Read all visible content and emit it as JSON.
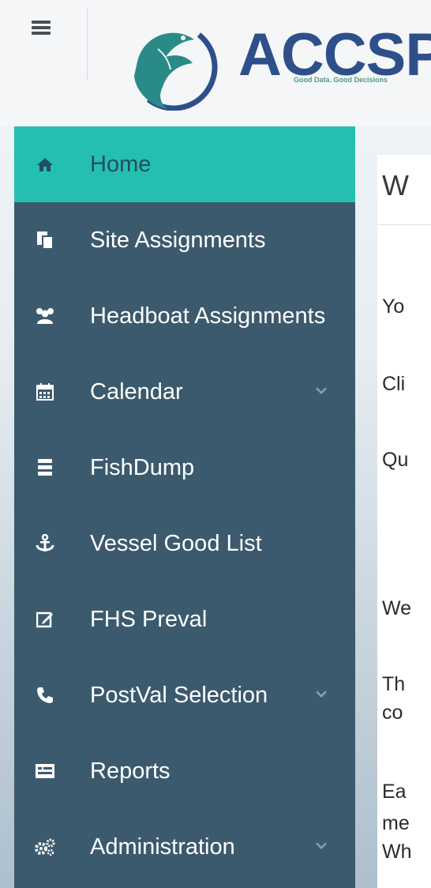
{
  "header": {
    "brand": "ACCSP",
    "tagline": "Good Data. Good Decisions"
  },
  "sidebar": {
    "items": [
      {
        "label": "Home",
        "icon": "home-icon",
        "active": true
      },
      {
        "label": "Site Assignments",
        "icon": "file-copy-icon"
      },
      {
        "label": "Headboat Assignments",
        "icon": "users-icon"
      },
      {
        "label": "Calendar",
        "icon": "calendar-icon",
        "expandable": true
      },
      {
        "label": "FishDump",
        "icon": "database-icon"
      },
      {
        "label": "Vessel Good List",
        "icon": "anchor-icon"
      },
      {
        "label": "FHS Preval",
        "icon": "edit-icon"
      },
      {
        "label": "PostVal Selection",
        "icon": "phone-icon",
        "expandable": true
      },
      {
        "label": "Reports",
        "icon": "report-icon"
      },
      {
        "label": "Administration",
        "icon": "cogs-icon",
        "expandable": true
      }
    ]
  },
  "content": {
    "title": "W",
    "lines": [
      "Yo",
      "Cli",
      "Qu",
      "We",
      "Th",
      "co",
      "Ea",
      "me",
      "Wh"
    ]
  },
  "colors": {
    "sidebar_bg": "#3c5a6d",
    "active_bg": "#25bfb2",
    "brand": "#2e4f8a",
    "accent": "#2a8a86"
  }
}
